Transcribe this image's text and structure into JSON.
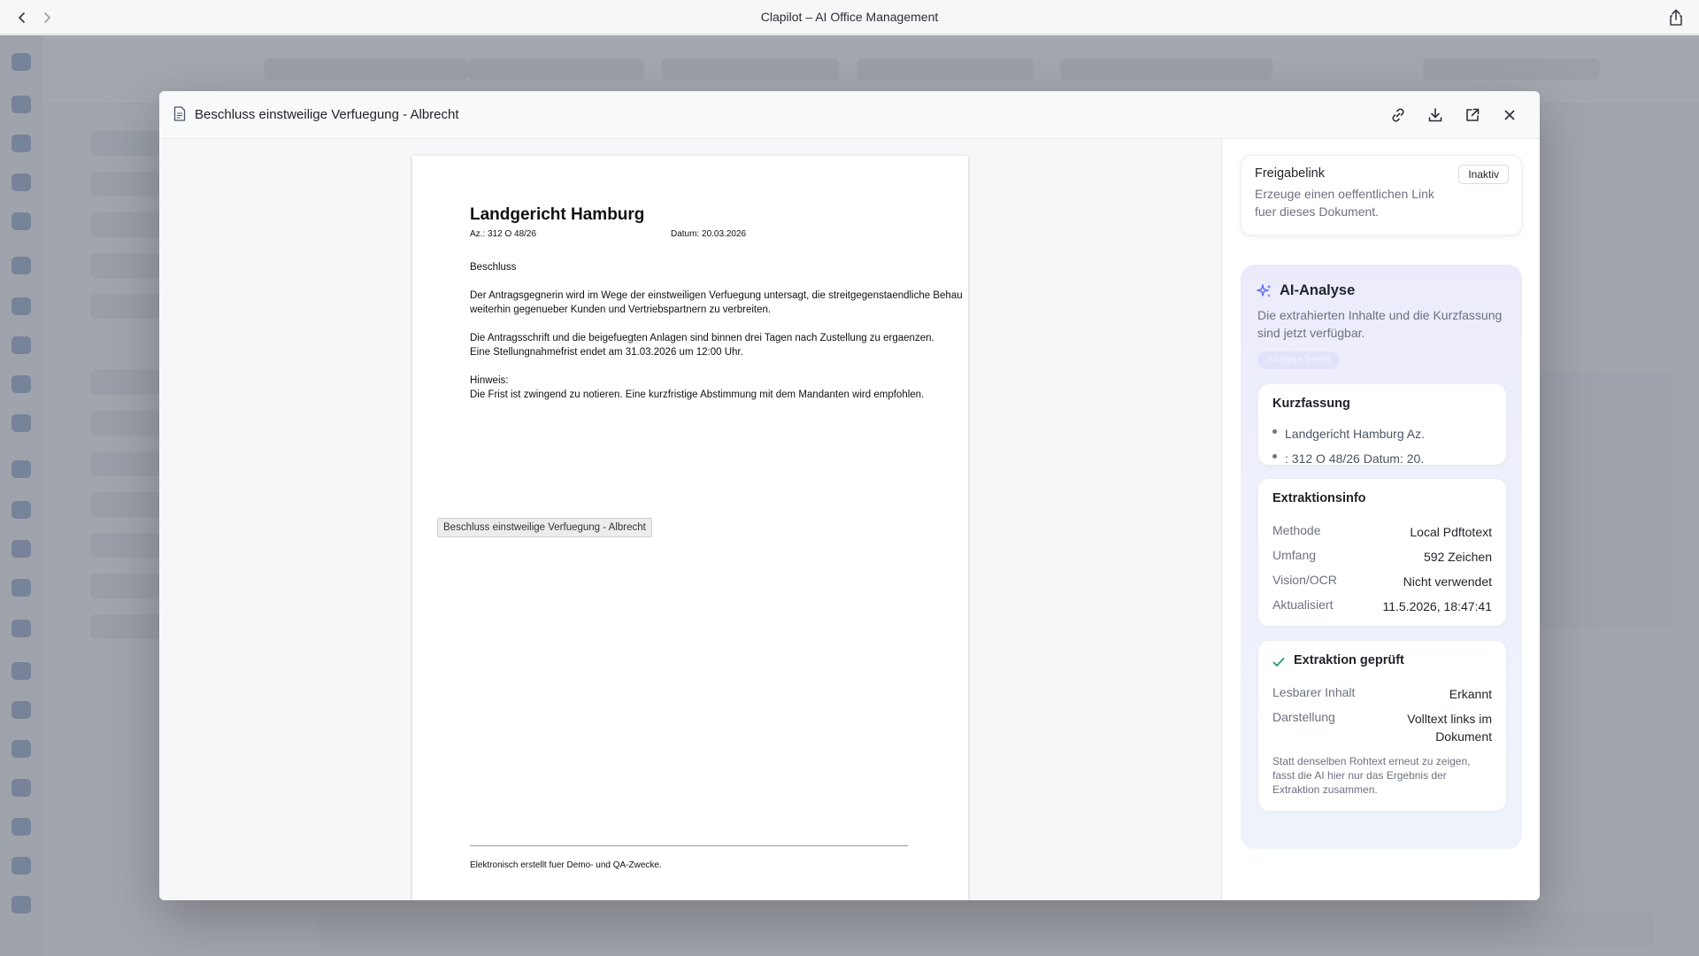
{
  "window": {
    "title": "Clapilot – AI Office Management"
  },
  "modal": {
    "title": "Beschluss einstweilige Verfuegung - Albrecht"
  },
  "document": {
    "court": "Landgericht Hamburg",
    "case_number": "Az.: 312 O 48/26",
    "date": "Datum: 20.03.2026",
    "heading": "Beschluss",
    "para1_line1": "Der Antragsgegnerin wird im Wege der einstweiligen Verfuegung untersagt, die streitgegenstaendliche Behau",
    "para1_line2": "weiterhin gegenueber Kunden und Vertriebspartnern zu verbreiten.",
    "para2_line1": "Die Antragsschrift und die beigefuegten Anlagen sind binnen drei Tagen nach Zustellung zu ergaenzen.",
    "para2_line2": "Eine Stellungnahmefrist endet am 31.03.2026 um 12:00 Uhr.",
    "note_label": "Hinweis:",
    "note_text": "Die Frist ist zwingend zu notieren. Eine kurzfristige Abstimmung mit dem Mandanten wird empfohlen.",
    "tooltip": "Beschluss einstweilige Verfuegung - Albrecht",
    "footer": "Elektronisch erstellt fuer Demo- und QA-Zwecke."
  },
  "share": {
    "title": "Freigabelink",
    "badge": "Inaktiv",
    "description": "Erzeuge einen oeffentlichen Link fuer dieses Dokument."
  },
  "ai": {
    "title": "AI-Analyse",
    "description": "Die extrahierten Inhalte und die Kurzfassung sind jetzt verfügbar.",
    "status": "Analyse bereit",
    "summary": {
      "title": "Kurzfassung",
      "bullets": [
        "Landgericht Hamburg Az.",
        ": 312 O 48/26 Datum: 20."
      ]
    },
    "extraction": {
      "title": "Extraktionsinfo",
      "rows": [
        {
          "key": "Methode",
          "value": "Local Pdftotext"
        },
        {
          "key": "Umfang",
          "value": "592 Zeichen"
        },
        {
          "key": "Vision/OCR",
          "value": "Nicht verwendet"
        },
        {
          "key": "Aktualisiert",
          "value": "11.5.2026, 18:47:41"
        }
      ]
    },
    "check": {
      "title": "Extraktion geprüft",
      "rows": [
        {
          "key": "Lesbarer Inhalt",
          "value": "Erkannt"
        },
        {
          "key": "Darstellung",
          "value": "Volltext links im Dokument"
        }
      ],
      "note": "Statt denselben Rohtext erneut zu zeigen, fasst die AI hier nur das Ergebnis der Extraktion zusammen."
    }
  },
  "colors": {
    "accent": "#5b6cf0",
    "check_green": "#1f9d6b",
    "overlay": "#5f6470"
  },
  "icons": [
    "chevron-left-icon",
    "chevron-right-icon",
    "share-icon",
    "document-icon",
    "link-icon",
    "download-icon",
    "external-link-icon",
    "close-icon",
    "sparkles-icon",
    "check-icon"
  ]
}
